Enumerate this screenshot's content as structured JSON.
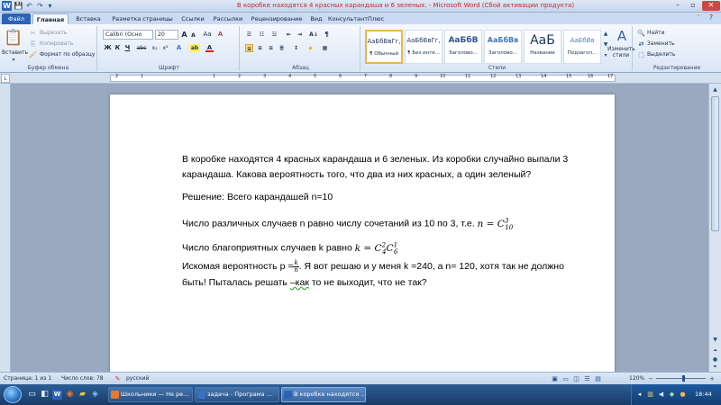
{
  "window": {
    "title": "В коробке находятся 4 красных карандаша и 6 зеленых. - Microsoft Word (Сбой активации продукта)",
    "controls": {
      "minimize": "–",
      "maximize": "▫",
      "close": "✕"
    }
  },
  "quick_access": {
    "save_icon": "💾",
    "undo_icon": "↶",
    "redo_icon": "↷",
    "customize_icon": "▾"
  },
  "tabs": [
    "Файл",
    "Главная",
    "Вставка",
    "Разметка страницы",
    "Ссылки",
    "Рассылки",
    "Рецензирование",
    "Вид",
    "КонсультантПлюс"
  ],
  "ribbon": {
    "clipboard": {
      "label": "Буфер обмена",
      "paste": "Вставить",
      "cut": "Вырезать",
      "copy": "Копировать",
      "format_painter": "Формат по образцу"
    },
    "font": {
      "label": "Шрифт",
      "family": "Calibri (Осно",
      "size": "20",
      "grow": "A",
      "shrink": "A",
      "case": "Aa",
      "clear": "A",
      "bold": "Ж",
      "italic": "К",
      "underline": "Ч",
      "strike": "abc",
      "subscript": "x₂",
      "superscript": "x²",
      "effects": "A",
      "highlight": "ab",
      "color": "A"
    },
    "paragraph": {
      "label": "Абзац",
      "sort": "А↓",
      "marks": "¶"
    },
    "styles": {
      "label": "Стили",
      "items": [
        {
          "preview": "АаБбВвГг,",
          "name": "¶ Обычный"
        },
        {
          "preview": "АаБбВвГг,",
          "name": "¶ Без инте..."
        },
        {
          "preview": "АаБбВ",
          "name": "Заголово..."
        },
        {
          "preview": "АаБбВв",
          "name": "Заголово..."
        },
        {
          "preview": "АаБ",
          "name": "Название"
        },
        {
          "preview": "АаБбВв",
          "name": "Подзагол..."
        }
      ],
      "change": "Изменить стили"
    },
    "editing": {
      "label": "Редактирование",
      "find": "Найти",
      "replace": "Заменить",
      "select": "Выделить"
    }
  },
  "ruler": {
    "numbers": [
      "2",
      "1",
      "1",
      "2",
      "3",
      "4",
      "5",
      "6",
      "7",
      "8",
      "9",
      "10",
      "11",
      "12",
      "13",
      "14",
      "15",
      "16",
      "17"
    ]
  },
  "document": {
    "p1": "В коробке находятся 4 красных карандаша и 6 зеленых.  Из коробки случайно выпали 3 карандаша. Какова вероятность  того, что два из них красных, а один зеленый?",
    "p2": "Решение:  Всего карандашей n=10",
    "p3_text": "Число различных случаев n равно числу сочетаний из 10 по 3, т.е. ",
    "p3_formula": "n = C",
    "p3_sup": "3",
    "p3_sub": "10",
    "p4_text": "Число благоприятных случаев k равно ",
    "p4_formula_k": "k = C",
    "p4_sup1": "2",
    "p4_sub1": "4",
    "p4_c": "C",
    "p4_sup2": "1",
    "p4_sub2": "6",
    "p5_a": "Искомая вероятность р =",
    "p5_num": "k",
    "p5_den": "n",
    "p5_b": ".  Я вот решаю и у меня k =240, а n= 120, хотя так не должно быть! Пыталась решать ",
    "p5_c": "–как",
    "p5_d": " то не выходит, что не так?"
  },
  "statusbar": {
    "page": "Страница: 1 из 1",
    "words": "Число слов: 78",
    "language": "русский",
    "zoom": "120%"
  },
  "taskbar": {
    "start_icon": "windows-orb",
    "items": [
      {
        "label": "Школьники — Не ре...",
        "color": "#e8782b"
      },
      {
        "label": "задача - Програма ...",
        "color": "#3a6fc2"
      },
      {
        "label": "В коробке находятся ...",
        "color": "#2a64b8"
      }
    ],
    "time": "18:44"
  }
}
